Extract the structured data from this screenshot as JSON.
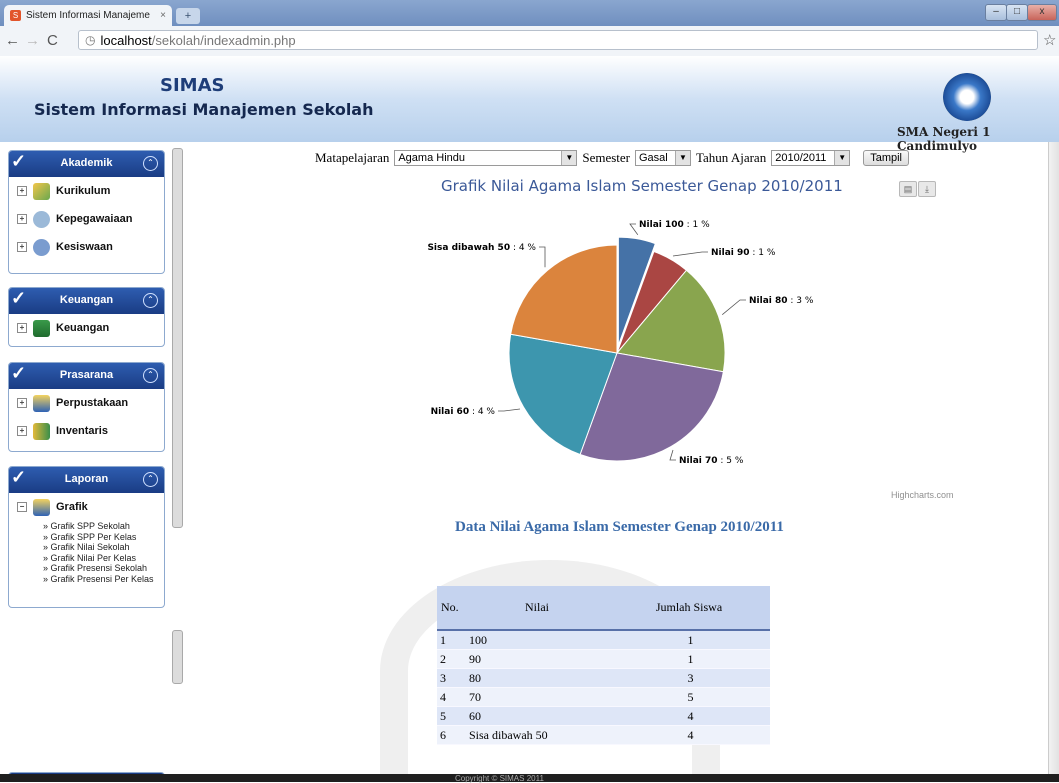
{
  "browser": {
    "tab_title": "Sistem Informasi Manajeme",
    "tab_close": "×",
    "url_host": "localhost",
    "url_path": "/sekolah/indexadmin.php"
  },
  "header": {
    "brand": "SIMAS",
    "subtitle": "Sistem Informasi Manajemen Sekolah",
    "school": "SMA Negeri 1 Candimulyo"
  },
  "sidebar": {
    "panels": [
      {
        "title": "Akademik",
        "items": [
          "Kurikulum",
          "Kepegawaiaan",
          "Kesiswaan"
        ]
      },
      {
        "title": "Keuangan",
        "items": [
          "Keuangan"
        ]
      },
      {
        "title": "Prasarana",
        "items": [
          "Perpustakaan",
          "Inventaris"
        ]
      },
      {
        "title": "Laporan",
        "items": [
          "Grafik"
        ],
        "links": [
          "» Grafik SPP Sekolah",
          "» Grafik SPP Per Kelas",
          "» Grafik Nilai Sekolah",
          "» Grafik Nilai Per Kelas",
          "» Grafik Presensi Sekolah",
          "» Grafik Presensi Per Kelas"
        ]
      }
    ]
  },
  "filter": {
    "mapel_label": "Matapelajaran",
    "mapel_value": "Agama Hindu",
    "semester_label": "Semester",
    "semester_value": "Gasal",
    "tahun_label": "Tahun Ajaran",
    "tahun_value": "2010/2011",
    "submit": "Tampil"
  },
  "chart_data": {
    "type": "pie",
    "title": "Grafik Nilai Agama Islam Semester Genap 2010/2011",
    "categories": [
      "Nilai 100",
      "Nilai 90",
      "Nilai 80",
      "Nilai 70",
      "Nilai 60",
      "Sisa dibawah 50"
    ],
    "values": [
      1,
      1,
      3,
      5,
      4,
      4
    ],
    "labels": [
      " : 1 %",
      " : 1 %",
      " : 3 %",
      " : 5 %",
      " : 4 %",
      " : 4 %"
    ],
    "colors": [
      "#4572a7",
      "#aa4643",
      "#89a54e",
      "#80699b",
      "#3d96ae",
      "#db843d"
    ],
    "credit": "Highcharts.com"
  },
  "data_table": {
    "title": "Data Nilai Agama Islam Semester Genap 2010/2011",
    "headers": [
      "No.",
      "Nilai",
      "Jumlah Siswa"
    ],
    "rows": [
      [
        "1",
        "100",
        "1"
      ],
      [
        "2",
        "90",
        "1"
      ],
      [
        "3",
        "80",
        "3"
      ],
      [
        "4",
        "70",
        "5"
      ],
      [
        "5",
        "60",
        "4"
      ],
      [
        "6",
        "Sisa dibawah 50",
        "4"
      ]
    ]
  },
  "footer": {
    "text": "Copyright © SIMAS 2011"
  }
}
